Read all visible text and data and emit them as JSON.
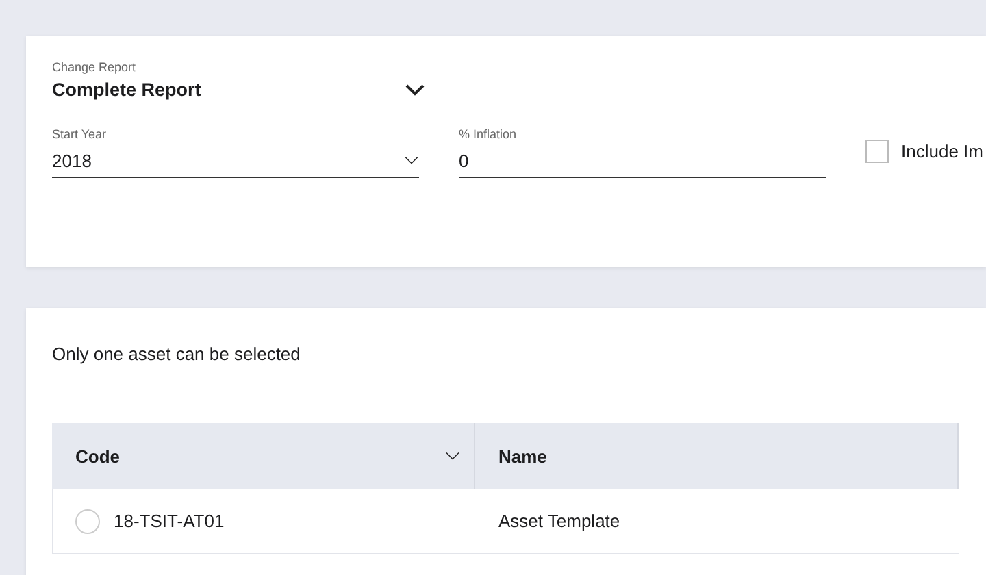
{
  "report_card": {
    "change_report": {
      "label": "Change Report",
      "value": "Complete Report"
    },
    "start_year": {
      "label": "Start Year",
      "value": "2018"
    },
    "inflation": {
      "label": "% Inflation",
      "value": "0"
    },
    "include_checkbox": {
      "label": "Include Im",
      "checked": false
    }
  },
  "asset_card": {
    "hint": "Only one asset can be selected",
    "table": {
      "columns": [
        {
          "label": "Code",
          "sortable": true
        },
        {
          "label": "Name",
          "sortable": false
        }
      ],
      "rows": [
        {
          "code": "18-TSIT-AT01",
          "name": "Asset Template",
          "selected": false
        }
      ]
    }
  }
}
